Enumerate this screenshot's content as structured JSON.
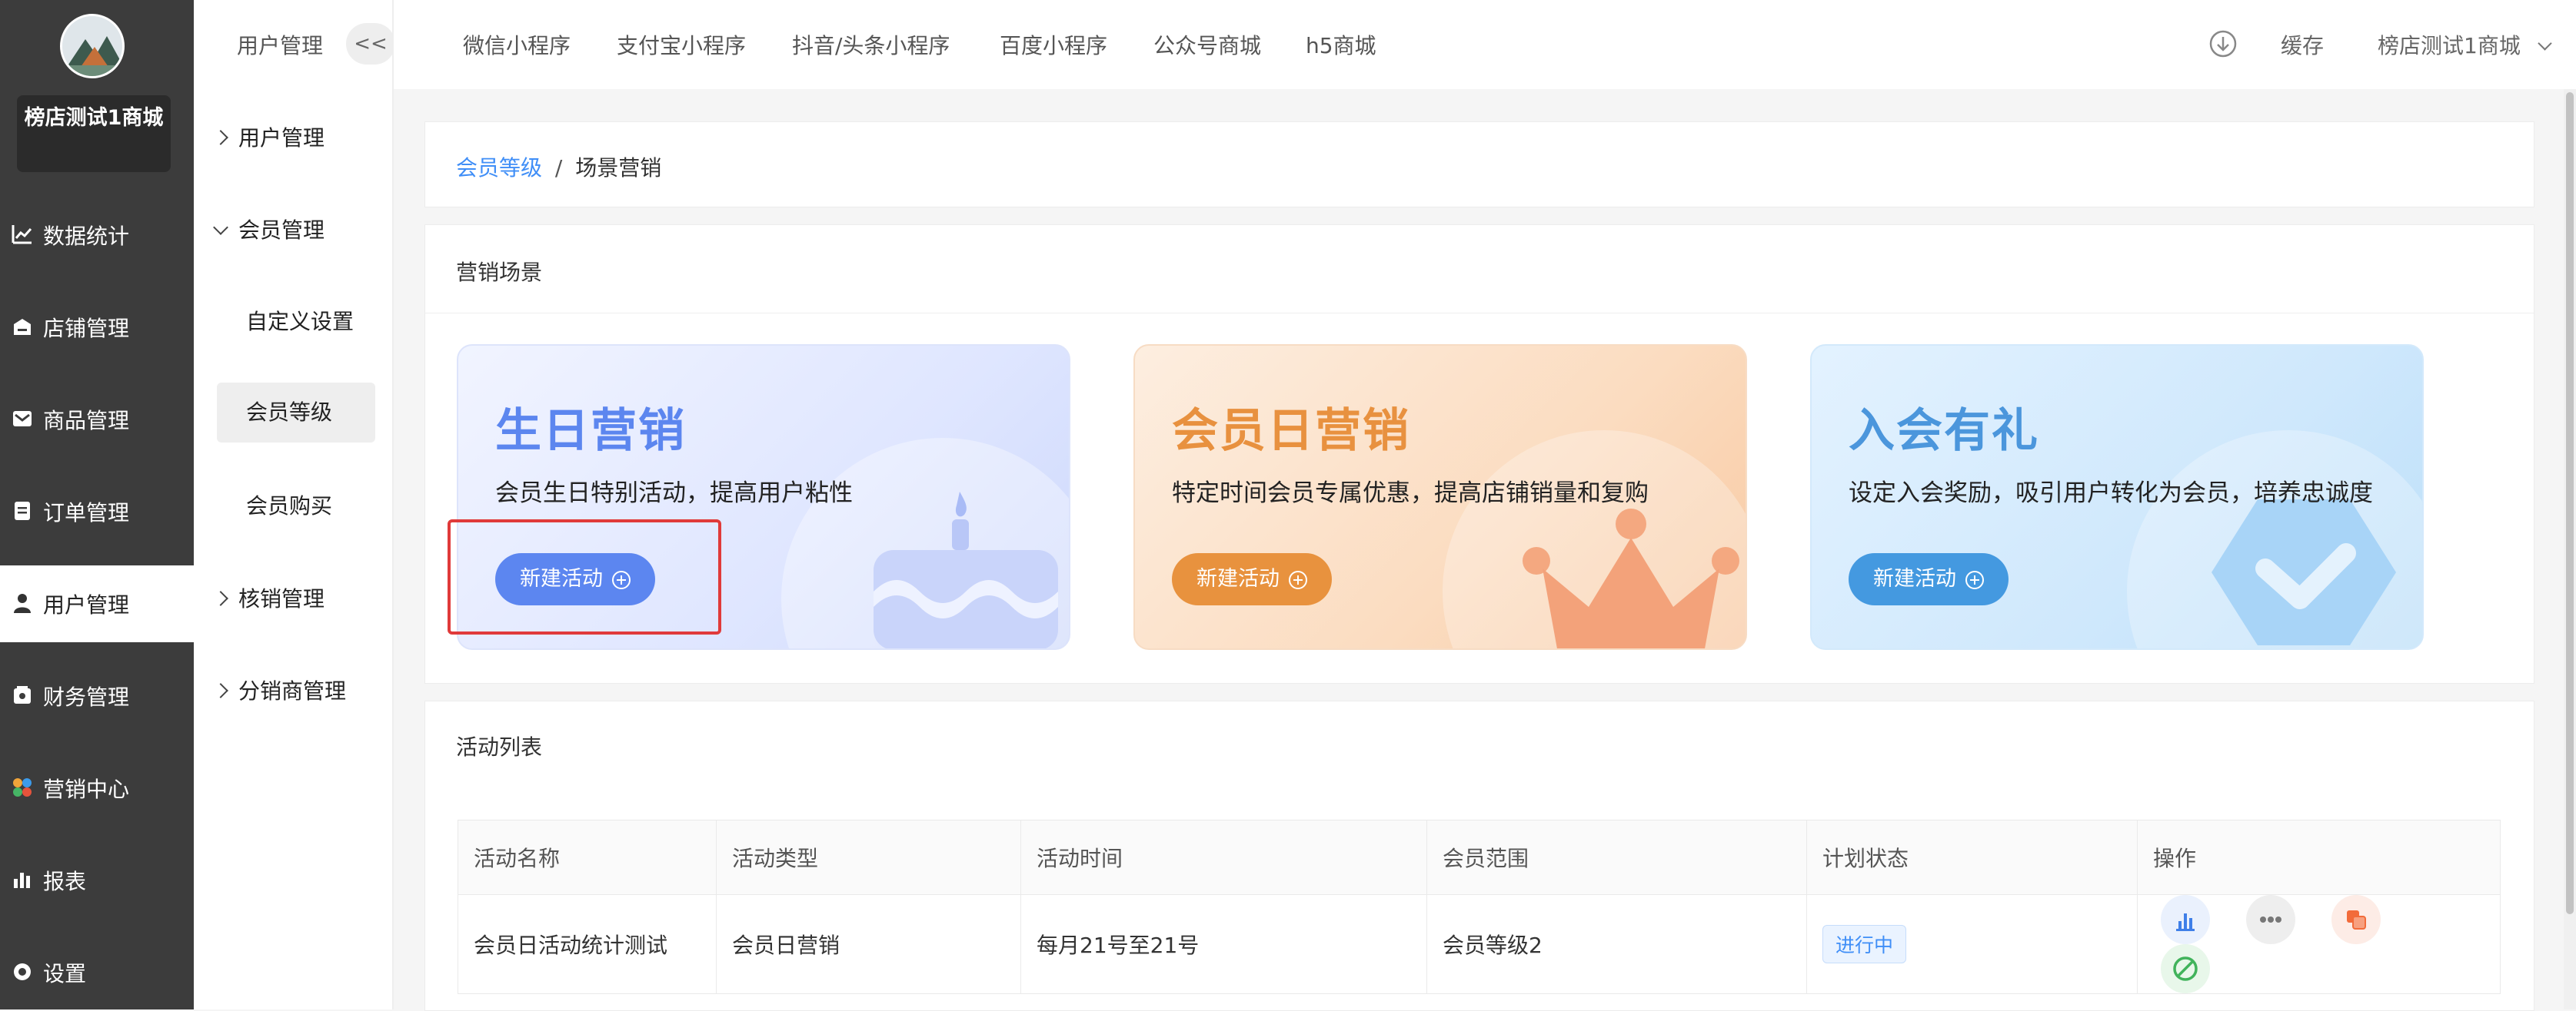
{
  "app": {
    "shop_name": "榜店测试1商城"
  },
  "left_nav": {
    "items": [
      {
        "label": "数据统计",
        "icon": "chart-line-icon"
      },
      {
        "label": "店铺管理",
        "icon": "store-icon"
      },
      {
        "label": "商品管理",
        "icon": "mail-icon"
      },
      {
        "label": "订单管理",
        "icon": "order-icon"
      },
      {
        "label": "用户管理",
        "icon": "user-icon",
        "active": true
      },
      {
        "label": "财务管理",
        "icon": "finance-icon"
      },
      {
        "label": "营销中心",
        "icon": "marketing-icon"
      },
      {
        "label": "报表",
        "icon": "report-icon"
      },
      {
        "label": "设置",
        "icon": "settings-icon"
      }
    ]
  },
  "sub_nav": {
    "title": "用户管理",
    "collapse_label": "<<",
    "groups": [
      {
        "label": "用户管理",
        "expanded": false
      },
      {
        "label": "会员管理",
        "expanded": true,
        "items": [
          "自定义设置",
          "会员等级",
          "会员购买"
        ]
      },
      {
        "label": "核销管理",
        "expanded": false
      },
      {
        "label": "分销商管理",
        "expanded": false
      }
    ],
    "active_item": "会员等级"
  },
  "top_bar": {
    "tabs": [
      "微信小程序",
      "支付宝小程序",
      "抖音/头条小程序",
      "百度小程序",
      "公众号商城",
      "h5商城"
    ],
    "cache_label": "缓存",
    "store_label": "榜店测试1商城"
  },
  "breadcrumb": {
    "parent": "会员等级",
    "separator": "/",
    "current": "场景营销"
  },
  "scenes": {
    "section_title": "营销场景",
    "cards": [
      {
        "title": "生日营销",
        "desc": "会员生日特别活动，提高用户粘性",
        "button": "新建活动",
        "accent": "#5f8af2",
        "button_color": "#5c86f0"
      },
      {
        "title": "会员日营销",
        "desc": "特定时间会员专属优惠，提高店铺销量和复购",
        "button": "新建活动",
        "accent": "#e89647",
        "button_color": "#e8923e"
      },
      {
        "title": "入会有礼",
        "desc": "设定入会奖励，吸引用户转化为会员，培养忠诚度",
        "button": "新建活动",
        "accent": "#4b96dc",
        "button_color": "#4499e0"
      }
    ]
  },
  "activity_list": {
    "title": "活动列表",
    "columns": [
      "活动名称",
      "活动类型",
      "活动时间",
      "会员范围",
      "计划状态",
      "操作"
    ],
    "rows": [
      {
        "name": "会员日活动统计测试",
        "type": "会员日营销",
        "time": "每月21号至21号",
        "scope": "会员等级2",
        "status": "进行中"
      }
    ],
    "row_actions": [
      "stats-icon",
      "more-icon",
      "copy-icon",
      "disable-icon"
    ]
  },
  "colors": {
    "highlight_box": "#e03a3a",
    "link": "#3f8ef7",
    "status_bg": "#eaf3ff",
    "status_text": "#3f8ef7"
  }
}
